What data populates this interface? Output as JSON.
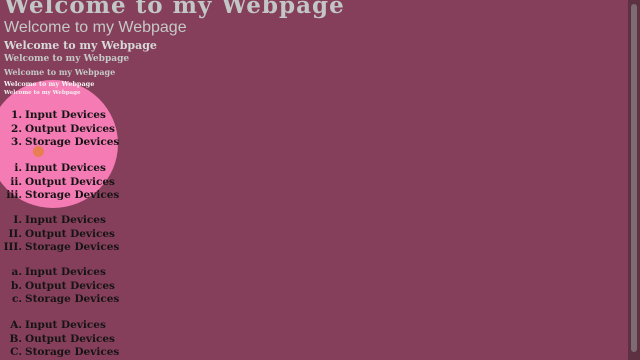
{
  "headings": {
    "h1": "Welcome to my Webpage",
    "h2": "Welcome to my Webpage",
    "h3": "Welcome to my Webpage",
    "h4": "Welcome to my Webpage",
    "h5": "Welcome to my Webpage",
    "h6": "Welcome to my Webpage",
    "h7": "Welcome to my Webpage"
  },
  "lists": [
    {
      "style": "decimal",
      "markers": [
        "1.",
        "2.",
        "3."
      ],
      "items": [
        "Input Devices",
        "Output Devices",
        "Storage Devices"
      ]
    },
    {
      "style": "lower-roman",
      "markers": [
        "i.",
        "ii.",
        "iii."
      ],
      "items": [
        "Input Devices",
        "Output Devices",
        "Storage Devices"
      ]
    },
    {
      "style": "upper-roman",
      "markers": [
        "I.",
        "II.",
        "III."
      ],
      "items": [
        "Input Devices",
        "Output Devices",
        "Storage Devices"
      ]
    },
    {
      "style": "lower-alpha",
      "markers": [
        "a.",
        "b.",
        "c."
      ],
      "items": [
        "Input Devices",
        "Output Devices",
        "Storage Devices"
      ]
    },
    {
      "style": "upper-alpha",
      "markers": [
        "A.",
        "B.",
        "C."
      ],
      "items": [
        "Input Devices",
        "Output Devices",
        "Storage Devices"
      ]
    }
  ],
  "colors": {
    "page_background": "#863f5b",
    "spotlight": "#f47bb3",
    "cursor": "#e6803f",
    "list_text": "#141414",
    "scrollbar_track": "#5d3142",
    "scrollbar_thumb": "#7d6a72"
  },
  "icons": {
    "cursor": "cursor-highlight-icon"
  }
}
